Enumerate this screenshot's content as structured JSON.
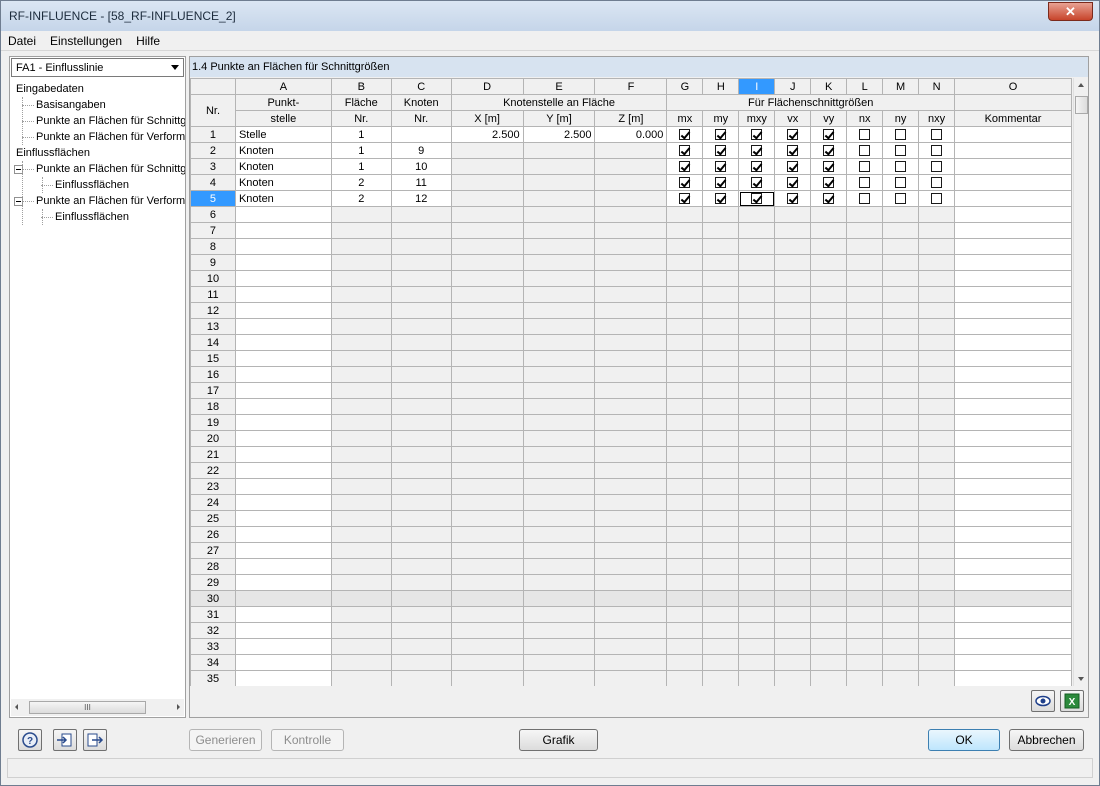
{
  "window": {
    "title": "RF-INFLUENCE - [58_RF-INFLUENCE_2]",
    "close_label": "✕"
  },
  "menu": [
    "Datei",
    "Einstellungen",
    "Hilfe"
  ],
  "left": {
    "combo_value": "FA1 - Einflusslinie",
    "tree": [
      {
        "label": "Eingabedaten",
        "level": 0
      },
      {
        "label": "Basisangaben",
        "level": 1
      },
      {
        "label": "Punkte an Flächen für Schnittgrößen",
        "level": 1
      },
      {
        "label": "Punkte an Flächen für Verformungen",
        "level": 1
      },
      {
        "label": "Einflussflächen",
        "level": 0
      },
      {
        "label": "Punkte an Flächen für Schnittgrößen",
        "level": 1,
        "expanded": true
      },
      {
        "label": "Einflussflächen",
        "level": 2
      },
      {
        "label": "Punkte an Flächen für Verformungen",
        "level": 1,
        "expanded": true
      },
      {
        "label": "Einflussflächen",
        "level": 2
      }
    ],
    "hscroll_thumb": "III"
  },
  "section": {
    "title": "1.4 Punkte an Flächen für Schnittgrößen"
  },
  "grid": {
    "col_letters": [
      "A",
      "B",
      "C",
      "D",
      "E",
      "F",
      "G",
      "H",
      "I",
      "J",
      "K",
      "L",
      "M",
      "N",
      "O"
    ],
    "header": {
      "nr": "Nr.",
      "punkt_1": "Punkt-",
      "punkt_2": "stelle",
      "flaeche_1": "Fläche",
      "flaeche_2": "Nr.",
      "knoten_1": "Knoten",
      "knoten_2": "Nr.",
      "knotenstelle": "Knotenstelle an Fläche",
      "x": "X [m]",
      "y": "Y [m]",
      "z": "Z [m]",
      "schnitt": "Für Flächenschnittgrößen",
      "mx": "mx",
      "my": "my",
      "mxy": "mxy",
      "vx": "vx",
      "vy": "vy",
      "nx": "nx",
      "ny": "ny",
      "nxy": "nxy",
      "kommentar": "Kommentar"
    },
    "rows": [
      {
        "nr": "1",
        "punktstelle": "Stelle",
        "flaeche": "1",
        "knoten": "",
        "x": "2.500",
        "y": "2.500",
        "z": "0.000",
        "checks": [
          true,
          true,
          true,
          true,
          true,
          false,
          false,
          false
        ]
      },
      {
        "nr": "2",
        "punktstelle": "Knoten",
        "flaeche": "1",
        "knoten": "9",
        "x": "",
        "y": "",
        "z": "",
        "checks": [
          true,
          true,
          true,
          true,
          true,
          false,
          false,
          false
        ]
      },
      {
        "nr": "3",
        "punktstelle": "Knoten",
        "flaeche": "1",
        "knoten": "10",
        "x": "",
        "y": "",
        "z": "",
        "checks": [
          true,
          true,
          true,
          true,
          true,
          false,
          false,
          false
        ]
      },
      {
        "nr": "4",
        "punktstelle": "Knoten",
        "flaeche": "2",
        "knoten": "11",
        "x": "",
        "y": "",
        "z": "",
        "checks": [
          true,
          true,
          true,
          true,
          true,
          false,
          false,
          false
        ]
      },
      {
        "nr": "5",
        "punktstelle": "Knoten",
        "flaeche": "2",
        "knoten": "12",
        "x": "",
        "y": "",
        "z": "",
        "checks": [
          true,
          true,
          true,
          true,
          true,
          false,
          false,
          false
        ]
      }
    ],
    "empty_rows": [
      "6",
      "7",
      "8",
      "9",
      "10",
      "11",
      "12",
      "13",
      "14",
      "15",
      "16",
      "17",
      "18",
      "19",
      "20",
      "21",
      "22",
      "23",
      "24",
      "25",
      "26",
      "27",
      "28",
      "29",
      "30",
      "31",
      "32",
      "33",
      "34",
      "35"
    ],
    "selected_row": "5",
    "selected_col": "I",
    "highlight_row": "30"
  },
  "buttons": {
    "generieren": "Generieren",
    "kontrolle": "Kontrolle",
    "grafik": "Grafik",
    "ok": "OK",
    "abbrechen": "Abbrechen"
  },
  "colors": {
    "selection": "#3399ff",
    "section_header": "#d7e3f0"
  }
}
